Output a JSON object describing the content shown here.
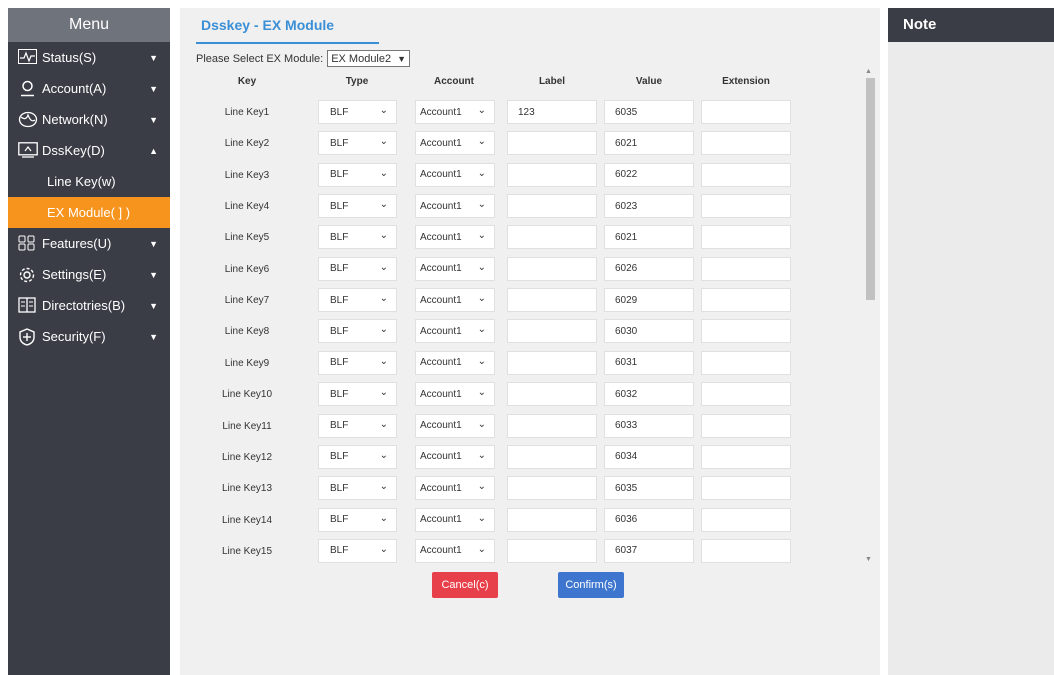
{
  "sidebar": {
    "title": "Menu",
    "items": [
      {
        "label": "Status(S)",
        "icon": "status-monitor-icon",
        "arrow": "▼"
      },
      {
        "label": "Account(A)",
        "icon": "account-user-icon",
        "arrow": "▼"
      },
      {
        "label": "Network(N)",
        "icon": "network-globe-icon",
        "arrow": "▼"
      },
      {
        "label": "DssKey(D)",
        "icon": "dsskey-screen-icon",
        "arrow": "▲",
        "subitems": [
          {
            "label": "Line Key(w)",
            "active": false
          },
          {
            "label": "EX Module( ] )",
            "active": true
          }
        ]
      },
      {
        "label": "Features(U)",
        "icon": "features-grid-icon",
        "arrow": "▼"
      },
      {
        "label": "Settings(E)",
        "icon": "settings-gear-icon",
        "arrow": "▼"
      },
      {
        "label": "Directotries(B)",
        "icon": "directory-book-icon",
        "arrow": "▼"
      },
      {
        "label": "Security(F)",
        "icon": "security-shield-icon",
        "arrow": "▼"
      }
    ]
  },
  "main": {
    "title": "Dsskey - EX Module",
    "select_label": "Please Select EX Module:",
    "select_value": "EX Module2",
    "columns": {
      "key": "Key",
      "type": "Type",
      "account": "Account",
      "label": "Label",
      "value": "Value",
      "extension": "Extension"
    },
    "rows": [
      {
        "key": "Line Key1",
        "type": "BLF",
        "account": "Account1",
        "label": "123",
        "value": "6035",
        "extension": ""
      },
      {
        "key": "Line Key2",
        "type": "BLF",
        "account": "Account1",
        "label": "",
        "value": "6021",
        "extension": ""
      },
      {
        "key": "Line Key3",
        "type": "BLF",
        "account": "Account1",
        "label": "",
        "value": "6022",
        "extension": ""
      },
      {
        "key": "Line Key4",
        "type": "BLF",
        "account": "Account1",
        "label": "",
        "value": "6023",
        "extension": ""
      },
      {
        "key": "Line Key5",
        "type": "BLF",
        "account": "Account1",
        "label": "",
        "value": "6021",
        "extension": ""
      },
      {
        "key": "Line Key6",
        "type": "BLF",
        "account": "Account1",
        "label": "",
        "value": "6026",
        "extension": ""
      },
      {
        "key": "Line Key7",
        "type": "BLF",
        "account": "Account1",
        "label": "",
        "value": "6029",
        "extension": ""
      },
      {
        "key": "Line Key8",
        "type": "BLF",
        "account": "Account1",
        "label": "",
        "value": "6030",
        "extension": ""
      },
      {
        "key": "Line Key9",
        "type": "BLF",
        "account": "Account1",
        "label": "",
        "value": "6031",
        "extension": ""
      },
      {
        "key": "Line Key10",
        "type": "BLF",
        "account": "Account1",
        "label": "",
        "value": "6032",
        "extension": ""
      },
      {
        "key": "Line Key11",
        "type": "BLF",
        "account": "Account1",
        "label": "",
        "value": "6033",
        "extension": ""
      },
      {
        "key": "Line Key12",
        "type": "BLF",
        "account": "Account1",
        "label": "",
        "value": "6034",
        "extension": ""
      },
      {
        "key": "Line Key13",
        "type": "BLF",
        "account": "Account1",
        "label": "",
        "value": "6035",
        "extension": ""
      },
      {
        "key": "Line Key14",
        "type": "BLF",
        "account": "Account1",
        "label": "",
        "value": "6036",
        "extension": ""
      },
      {
        "key": "Line Key15",
        "type": "BLF",
        "account": "Account1",
        "label": "",
        "value": "6037",
        "extension": ""
      }
    ],
    "cancel_label": "Cancel(c)",
    "confirm_label": "Confirm(s)"
  },
  "note": {
    "title": "Note"
  },
  "colors": {
    "accent": "#3b8fd6",
    "active_menu": "#f7941d",
    "cancel": "#e8404a",
    "confirm": "#3e76cf",
    "sidebar_bg": "#3a3d45"
  }
}
